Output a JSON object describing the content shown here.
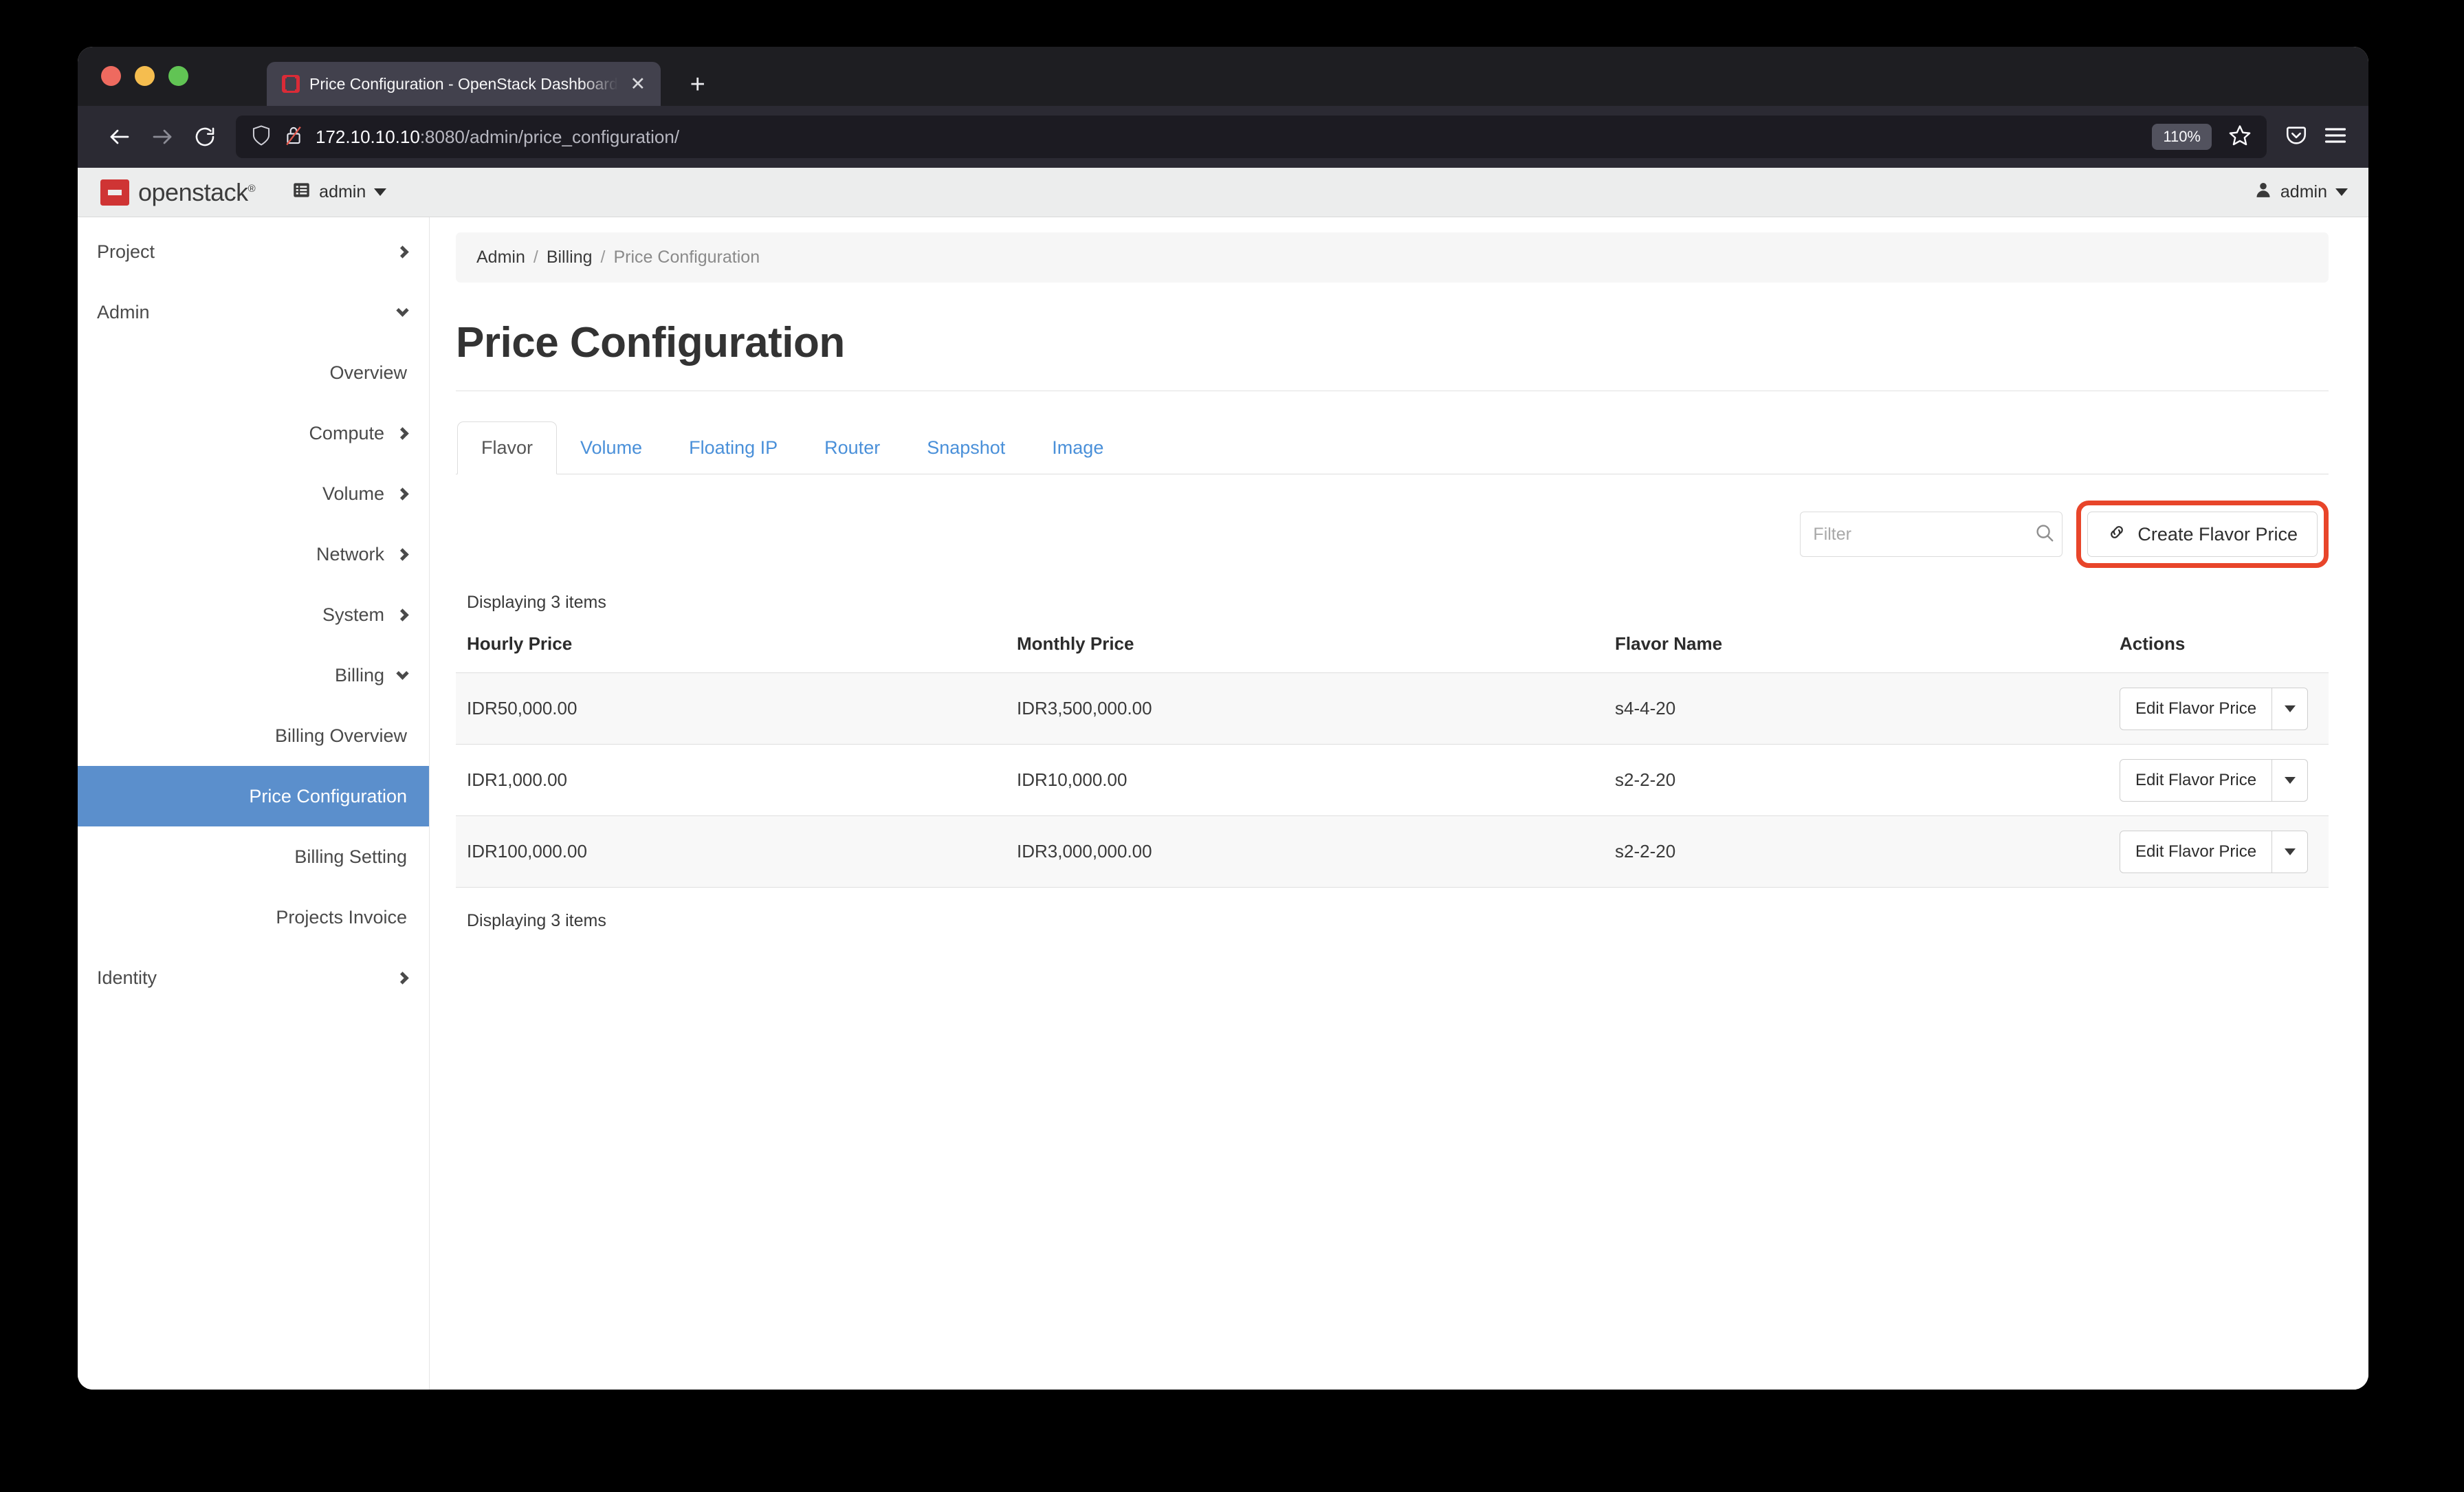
{
  "browser": {
    "tab": {
      "title": "Price Configuration - OpenStack Dashboard",
      "close_label": "✕"
    },
    "new_tab_label": "+",
    "nav": {
      "back": "←",
      "forward": "→",
      "reload": "↻"
    },
    "url": {
      "host": "172.10.10.10",
      "path": ":8080/admin/price_configuration/"
    },
    "zoom_level": "110%"
  },
  "os_header": {
    "logo_text": "openstack",
    "logo_trademark": "®",
    "project_label": "admin",
    "user_label": "admin"
  },
  "sidebar": {
    "items": [
      {
        "label": "Project",
        "level": 1,
        "icon": "chevron-right-icon",
        "active": false
      },
      {
        "label": "Admin",
        "level": 1,
        "icon": "chevron-down-icon",
        "active": false
      },
      {
        "label": "Overview",
        "level": 3,
        "icon": "none",
        "active": false
      },
      {
        "label": "Compute",
        "level": 2,
        "icon": "chevron-right-icon",
        "active": false
      },
      {
        "label": "Volume",
        "level": 2,
        "icon": "chevron-right-icon",
        "active": false
      },
      {
        "label": "Network",
        "level": 2,
        "icon": "chevron-right-icon",
        "active": false
      },
      {
        "label": "System",
        "level": 2,
        "icon": "chevron-right-icon",
        "active": false
      },
      {
        "label": "Billing",
        "level": 2,
        "icon": "chevron-down-icon",
        "active": false
      },
      {
        "label": "Billing Overview",
        "level": 3,
        "icon": "none",
        "active": false
      },
      {
        "label": "Price Configuration",
        "level": 3,
        "icon": "none",
        "active": true
      },
      {
        "label": "Billing Setting",
        "level": 3,
        "icon": "none",
        "active": false
      },
      {
        "label": "Projects Invoice",
        "level": 3,
        "icon": "none",
        "active": false
      },
      {
        "label": "Identity",
        "level": 1,
        "icon": "chevron-right-icon",
        "active": false
      }
    ]
  },
  "breadcrumb": {
    "items": [
      "Admin",
      "Billing",
      "Price Configuration"
    ],
    "separator": "/"
  },
  "page": {
    "title": "Price Configuration"
  },
  "tabs": [
    {
      "label": "Flavor",
      "active": true
    },
    {
      "label": "Volume",
      "active": false
    },
    {
      "label": "Floating IP",
      "active": false
    },
    {
      "label": "Router",
      "active": false
    },
    {
      "label": "Snapshot",
      "active": false
    },
    {
      "label": "Image",
      "active": false
    }
  ],
  "toolbar": {
    "filter_placeholder": "Filter",
    "filter_value": "",
    "create_button_label": "Create Flavor Price",
    "create_button_icon": "link-chain-icon",
    "highlight_color": "#e8452a"
  },
  "table": {
    "count_top": "Displaying 3 items",
    "count_bottom": "Displaying 3 items",
    "columns": [
      "Hourly Price",
      "Monthly Price",
      "Flavor Name",
      "Actions"
    ],
    "action_label": "Edit Flavor Price",
    "rows": [
      {
        "hourly": "IDR50,000.00",
        "monthly": "IDR3,500,000.00",
        "flavor": "s4-4-20"
      },
      {
        "hourly": "IDR1,000.00",
        "monthly": "IDR10,000.00",
        "flavor": "s2-2-20"
      },
      {
        "hourly": "IDR100,000.00",
        "monthly": "IDR3,000,000.00",
        "flavor": "s2-2-20"
      }
    ]
  },
  "colors": {
    "accent": "#5b8fcc",
    "link": "#4a90d9",
    "brand_red": "#da2b37",
    "highlight": "#e8452a"
  }
}
